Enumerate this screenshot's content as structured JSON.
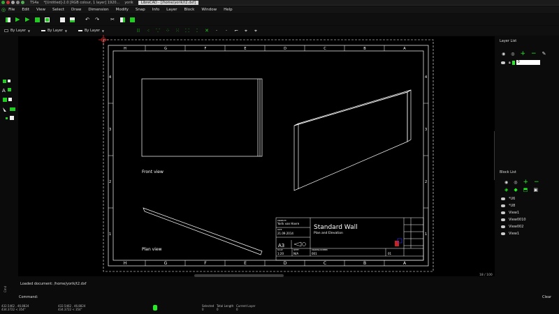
{
  "taskbar": {
    "items": [
      "TS4a",
      "*[Untitled]-2.0 [RGB colour, 1 layer] 1920...",
      "yorik"
    ],
    "active": "LibreCAD - [/home/yorik/t2.dxf]"
  },
  "menu": [
    "File",
    "Edit",
    "View",
    "Select",
    "Draw",
    "Dimension",
    "Modify",
    "Snap",
    "Info",
    "Layer",
    "Block",
    "Window",
    "Help"
  ],
  "toolbar2": {
    "color": "By Layer",
    "width": "By Layer",
    "linetype": "By Layer"
  },
  "drawing": {
    "front_label": "Front view",
    "plan_label": "Plan view",
    "col_labels_top": [
      "H",
      "G",
      "F",
      "E",
      "D",
      "C",
      "B",
      "A"
    ],
    "col_labels_bottom": [
      "H",
      "G",
      "F",
      "E",
      "D",
      "C",
      "B",
      "A"
    ],
    "row_labels_left": [
      "4",
      "3",
      "2",
      "1"
    ],
    "row_labels_right": [
      "4",
      "3",
      "2",
      "1"
    ],
    "title_block": {
      "title": "Standard Wall",
      "subtitle": "Plan and Elevation",
      "drawn_by_label": "DRAWN BY",
      "author": "Yorik van Havre",
      "date_label": "DATE",
      "date": "21.09.2014",
      "scale_label": "SCALE",
      "scale": "1:20",
      "size": "A3",
      "sheet_label": "SHEET",
      "sheet": "N/A",
      "drawing_no_label": "DRAWING NUMBER",
      "drawing_no": "001",
      "rev": "01"
    }
  },
  "colors": {
    "accent": "#22e322",
    "bg": "#000000",
    "line": "#ffffff"
  },
  "layer_list": {
    "title": "Layer List",
    "layers": [
      {
        "name": "0"
      }
    ]
  },
  "block_list": {
    "title": "Block List",
    "blocks": [
      "*U6",
      "*U8",
      "View1",
      "View0010",
      "View002",
      "View1"
    ]
  },
  "zoom_readout": "18 / 100",
  "command": {
    "message": "Loaded document: /home/yorik/t2.dxf",
    "prompt": "Command:",
    "clear": "Clear"
  },
  "status": {
    "abs1": "432.5462 , 46.8824",
    "abs2": "434.3722 < 354°",
    "rel1": "432.5462 , 46.8824",
    "rel2": "434.3722 < 354°",
    "selected_label": "Selected",
    "selected": "0",
    "length_label": "Total Length",
    "length": "0",
    "layer_label": "Current Layer",
    "layer": "0"
  }
}
